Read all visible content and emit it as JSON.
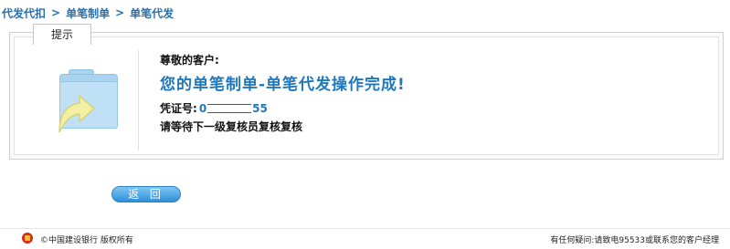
{
  "breadcrumb": {
    "items": [
      "代发代扣",
      "单笔制单",
      "单笔代发"
    ],
    "separator": ">"
  },
  "panel": {
    "tab_label": "提示",
    "icon": "folder-upload-icon"
  },
  "message": {
    "greeting": "尊敬的客户:",
    "success": "您的单笔制单-单笔代发操作完成!",
    "voucher_label": "凭证号:",
    "voucher_prefix": "0",
    "voucher_suffix": "55",
    "wait_text": "请等待下一级复核员复核复核"
  },
  "actions": {
    "back_label": "返 回"
  },
  "footer": {
    "copyright": "©中国建设银行  版权所有",
    "help": "有任何疑问:请致电95533或联系您的客户经理"
  },
  "colors": {
    "link": "#2a6fb0",
    "accent": "#1f78bf",
    "button": "#2f8fd8"
  }
}
